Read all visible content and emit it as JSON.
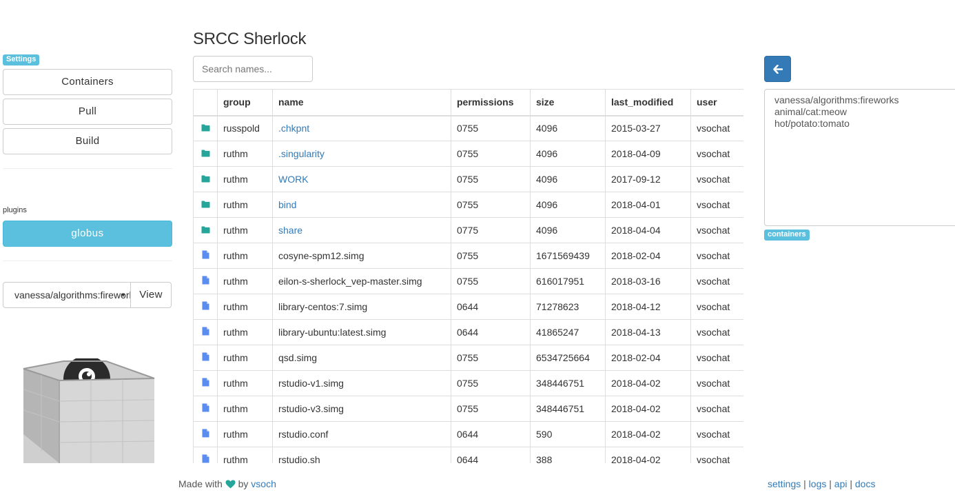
{
  "sidebar": {
    "settings_badge": "Settings",
    "buttons": [
      "Containers",
      "Pull",
      "Build"
    ],
    "plugins_label": "plugins",
    "plugin_button": "globus",
    "container_select": "vanessa/algorithms:fireworks",
    "view_button": "View"
  },
  "main": {
    "title": "SRCC Sherlock",
    "search_placeholder": "Search names...",
    "columns": [
      "group",
      "name",
      "permissions",
      "size",
      "last_modified",
      "user"
    ],
    "rows": [
      {
        "type": "folder",
        "group": "russpold",
        "name": ".chkpnt",
        "permissions": "0755",
        "size": "4096",
        "last_modified": "2015-03-27",
        "user": "vsochat"
      },
      {
        "type": "folder",
        "group": "ruthm",
        "name": ".singularity",
        "permissions": "0755",
        "size": "4096",
        "last_modified": "2018-04-09",
        "user": "vsochat"
      },
      {
        "type": "folder",
        "group": "ruthm",
        "name": "WORK",
        "permissions": "0755",
        "size": "4096",
        "last_modified": "2017-09-12",
        "user": "vsochat"
      },
      {
        "type": "folder",
        "group": "ruthm",
        "name": "bind",
        "permissions": "0755",
        "size": "4096",
        "last_modified": "2018-04-01",
        "user": "vsochat"
      },
      {
        "type": "folder",
        "group": "ruthm",
        "name": "share",
        "permissions": "0775",
        "size": "4096",
        "last_modified": "2018-04-04",
        "user": "vsochat"
      },
      {
        "type": "file",
        "group": "ruthm",
        "name": "cosyne-spm12.simg",
        "permissions": "0755",
        "size": "1671569439",
        "last_modified": "2018-02-04",
        "user": "vsochat"
      },
      {
        "type": "file",
        "group": "ruthm",
        "name": "eilon-s-sherlock_vep-master.simg",
        "permissions": "0755",
        "size": "616017951",
        "last_modified": "2018-03-16",
        "user": "vsochat"
      },
      {
        "type": "file",
        "group": "ruthm",
        "name": "library-centos:7.simg",
        "permissions": "0644",
        "size": "71278623",
        "last_modified": "2018-04-12",
        "user": "vsochat"
      },
      {
        "type": "file",
        "group": "ruthm",
        "name": "library-ubuntu:latest.simg",
        "permissions": "0644",
        "size": "41865247",
        "last_modified": "2018-04-13",
        "user": "vsochat"
      },
      {
        "type": "file",
        "group": "ruthm",
        "name": "qsd.simg",
        "permissions": "0755",
        "size": "6534725664",
        "last_modified": "2018-02-04",
        "user": "vsochat"
      },
      {
        "type": "file",
        "group": "ruthm",
        "name": "rstudio-v1.simg",
        "permissions": "0755",
        "size": "348446751",
        "last_modified": "2018-04-02",
        "user": "vsochat"
      },
      {
        "type": "file",
        "group": "ruthm",
        "name": "rstudio-v3.simg",
        "permissions": "0755",
        "size": "348446751",
        "last_modified": "2018-04-02",
        "user": "vsochat"
      },
      {
        "type": "file",
        "group": "ruthm",
        "name": "rstudio.conf",
        "permissions": "0644",
        "size": "590",
        "last_modified": "2018-04-02",
        "user": "vsochat"
      },
      {
        "type": "file",
        "group": "ruthm",
        "name": "rstudio.sh",
        "permissions": "0644",
        "size": "388",
        "last_modified": "2018-04-02",
        "user": "vsochat"
      }
    ]
  },
  "right_panel": {
    "back_icon": "arrow-left-icon",
    "containers": [
      "vanessa/algorithms:fireworks",
      "animal/cat:meow",
      "hot/potato:tomato"
    ],
    "containers_badge": "containers"
  },
  "footer": {
    "made_with": "Made with",
    "by": "by",
    "author": "vsoch",
    "links": [
      "settings",
      "logs",
      "api",
      "docs"
    ],
    "separator": "|"
  },
  "colors": {
    "folder": "#26a69a",
    "file": "#5b8def",
    "link": "#337ab7",
    "info": "#5bc0de",
    "primary": "#337ab7",
    "heart": "#26a69a"
  }
}
